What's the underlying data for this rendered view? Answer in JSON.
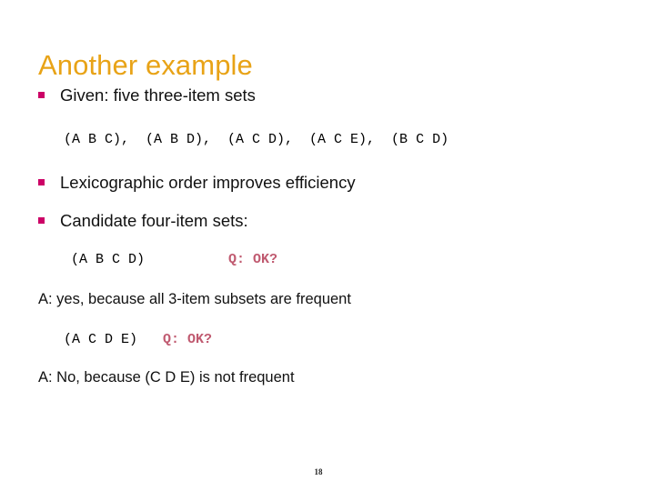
{
  "slide": {
    "title": "Another example",
    "page_number": "18",
    "colors": {
      "title": "#E8A317",
      "bullet_marker": "#CC0066",
      "question": "#C05A70",
      "body_text": "#111111",
      "background": "#FFFFFF"
    },
    "bullets": [
      {
        "label": "Given: five three-item sets"
      },
      {
        "label": "Lexicographic order improves efficiency"
      },
      {
        "label": "Candidate four-item sets:"
      }
    ],
    "item_sets_line": "(A B C),  (A B D),  (A C D),  (A C E),  (B C D)",
    "candidates": [
      {
        "set": "(A B C D)",
        "question": "Q: OK?",
        "answer": "A: yes, because all 3-item subsets are frequent"
      },
      {
        "set": "(A C D E)",
        "question": "Q: OK?",
        "answer": "A: No, because (C D E) is not frequent"
      }
    ]
  }
}
